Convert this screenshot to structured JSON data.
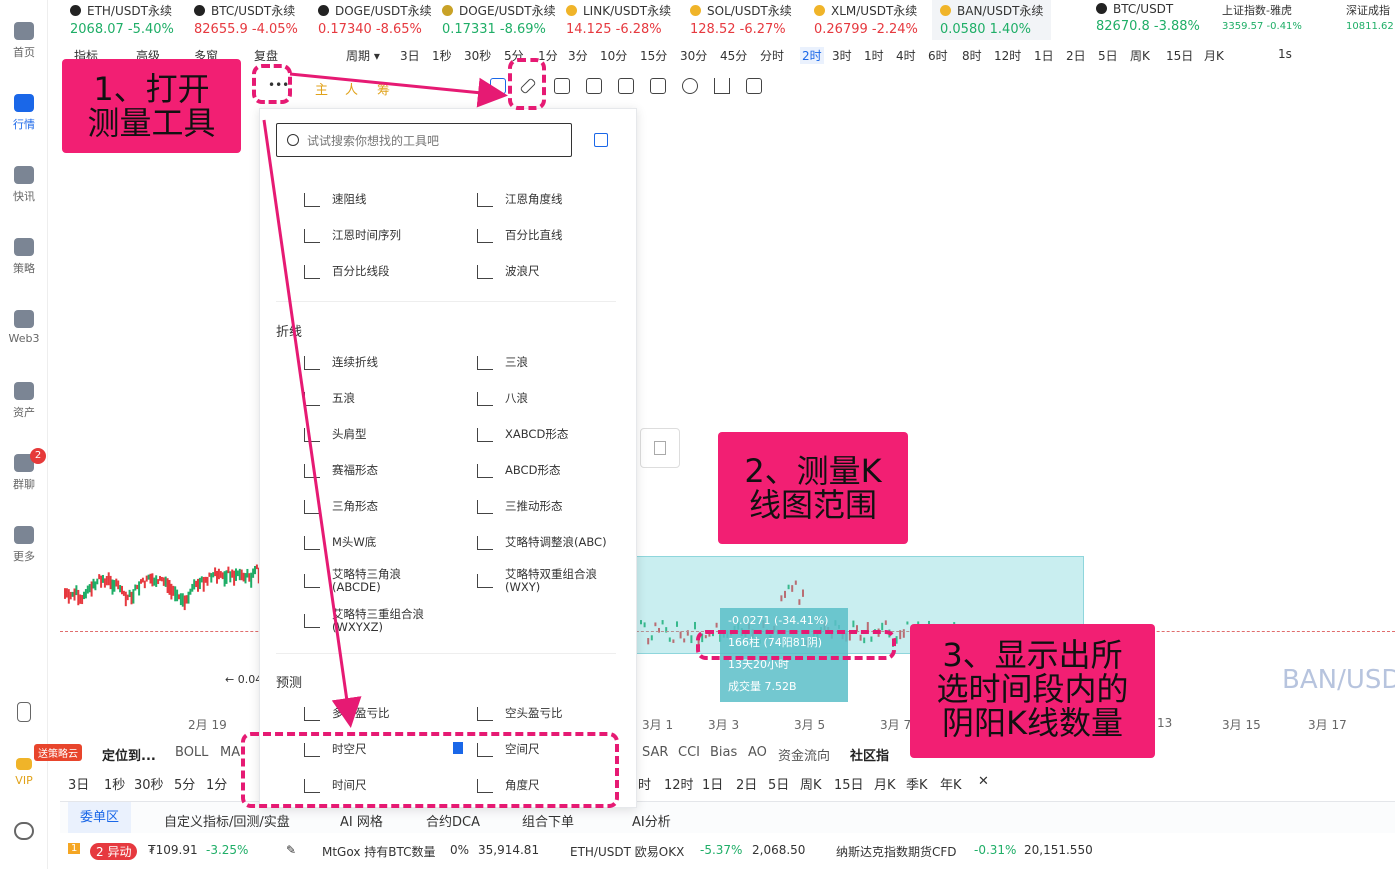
{
  "sidebar": {
    "items": [
      {
        "label": "首页",
        "icon": "home-icon"
      },
      {
        "label": "行情",
        "icon": "market-icon",
        "active": true
      },
      {
        "label": "快讯",
        "icon": "news-icon"
      },
      {
        "label": "策略",
        "icon": "robot-icon"
      },
      {
        "label": "Web3",
        "icon": "web3-icon"
      },
      {
        "label": "资产",
        "icon": "wallet-icon"
      },
      {
        "label": "群聊",
        "icon": "chat-icon",
        "badge": "2"
      },
      {
        "label": "更多",
        "icon": "more-grid-icon"
      }
    ],
    "vip_label": "VIP",
    "vip_badge": "送策略云"
  },
  "tickers": [
    {
      "name": "ETH/USDT永续",
      "price": "2068.07",
      "change": "-5.40%",
      "dir": "up"
    },
    {
      "name": "BTC/USDT永续",
      "price": "82655.9",
      "change": "-4.05%",
      "dir": "down"
    },
    {
      "name": "DOGE/USDT永续",
      "price": "0.17340",
      "change": "-8.65%",
      "dir": "down"
    },
    {
      "name": "DOGE/USDT永续",
      "price": "0.17331",
      "change": "-8.69%",
      "dir": "up"
    },
    {
      "name": "LINK/USDT永续",
      "price": "14.125",
      "change": "-6.28%",
      "dir": "down"
    },
    {
      "name": "SOL/USDT永续",
      "price": "128.52",
      "change": "-6.27%",
      "dir": "down"
    },
    {
      "name": "XLM/USDT永续",
      "price": "0.26799",
      "change": "-2.24%",
      "dir": "down"
    },
    {
      "name": "BAN/USDT永续",
      "price": "0.0580",
      "change": "1.40%",
      "dir": "up"
    },
    {
      "name": "BTC/USDT",
      "price": "82670.8",
      "change": "-3.88%",
      "dir": "up"
    },
    {
      "name": "上证指数-雅虎",
      "price": "3359.57",
      "change": "-0.41%",
      "dir": "up"
    },
    {
      "name": "深证成指",
      "price": "10811.62",
      "change": "",
      "dir": "up"
    }
  ],
  "period_bar": {
    "left": [
      "指标",
      "高级",
      "多窗",
      "复盘",
      "周期 ▾"
    ],
    "periods": [
      "3日",
      "1秒",
      "30秒",
      "5分",
      "1分",
      "3分",
      "10分",
      "15分",
      "30分",
      "45分",
      "分时",
      "2时",
      "3时",
      "1时",
      "4时",
      "6时",
      "8时",
      "12时",
      "1日",
      "2日",
      "5日",
      "周K",
      "15日",
      "月K"
    ],
    "active": "2时",
    "right": "1s"
  },
  "draw_bar": {
    "labels": [
      "主",
      "人",
      "筹"
    ]
  },
  "tool_panel": {
    "search_placeholder": "试试搜索你想找的工具吧",
    "group1": [
      "速阻线",
      "江恩角度线",
      "江恩时间序列",
      "百分比直线",
      "百分比线段",
      "波浪尺"
    ],
    "section_zigzag": "折线",
    "group2": [
      "连续折线",
      "三浪",
      "五浪",
      "八浪",
      "头肩型",
      "XABCD形态",
      "赛福形态",
      "ABCD形态",
      "三角形态",
      "三推动形态",
      "M头W底",
      "艾略特调整浪(ABC)",
      "艾略特三角浪(ABCDE)",
      "艾略特双重组合浪(WXY)",
      "艾略特三重组合浪(WXYXZ)"
    ],
    "section_forecast": "预测",
    "group3": [
      "多头盈亏比",
      "空头盈亏比",
      "时空尺",
      "空间尺",
      "时间尺",
      "角度尺"
    ]
  },
  "measure": {
    "change": "-0.0271 (-34.41%)",
    "bars": "166柱 (74阳81阴)",
    "duration": "13天20小时",
    "volume": "成交量 7.52B"
  },
  "chart": {
    "symbol": "BAN/USD",
    "low_label": "← 0.04",
    "dates": [
      "2月 19",
      "3月 1",
      "3月 3",
      "3月 5",
      "3月 7",
      "13",
      "3月 15",
      "3月 17"
    ]
  },
  "indicator_bar": {
    "left": [
      "定位到...",
      "BOLL",
      "MA"
    ],
    "right": [
      "SAR",
      "CCI",
      "Bias",
      "AO",
      "资金流向",
      "社区指"
    ]
  },
  "period_bar2": {
    "left": [
      "3日",
      "1秒",
      "30秒",
      "5分",
      "1分"
    ],
    "right": [
      "时",
      "12时",
      "1日",
      "2日",
      "5日",
      "周K",
      "15日",
      "月K",
      "季K",
      "年K",
      "✕"
    ]
  },
  "bottom_tabs": [
    "委单区",
    "自定义指标/回测/实盘",
    "AI 网格",
    "合约DCA",
    "组合下单",
    "AI分析"
  ],
  "news_bar": {
    "index": "1",
    "pill": "2 异动",
    "price": "₮109.91",
    "change": "-3.25%",
    "item1": "MtGox 持有BTC数量",
    "item1_val": "0%",
    "item1_num": "35,914.81",
    "item2": "ETH/USDT 欧易OKX",
    "item2_change": "-5.37%",
    "item2_val": "2,068.50",
    "item3": "纳斯达克指数期货CFD",
    "item3_change": "-0.31%",
    "item3_val": "20,151.550"
  },
  "annotations": {
    "note1": "1、打开\n测量工具",
    "note2": "2、测量K\n线图范围",
    "note3": "3、显示出所\n选时间段内的\n阴阳K线数量",
    "accent": "#f21f73"
  },
  "colors": {
    "up": "#1fae67",
    "down": "#e6393f",
    "accent": "#1a67e8"
  }
}
